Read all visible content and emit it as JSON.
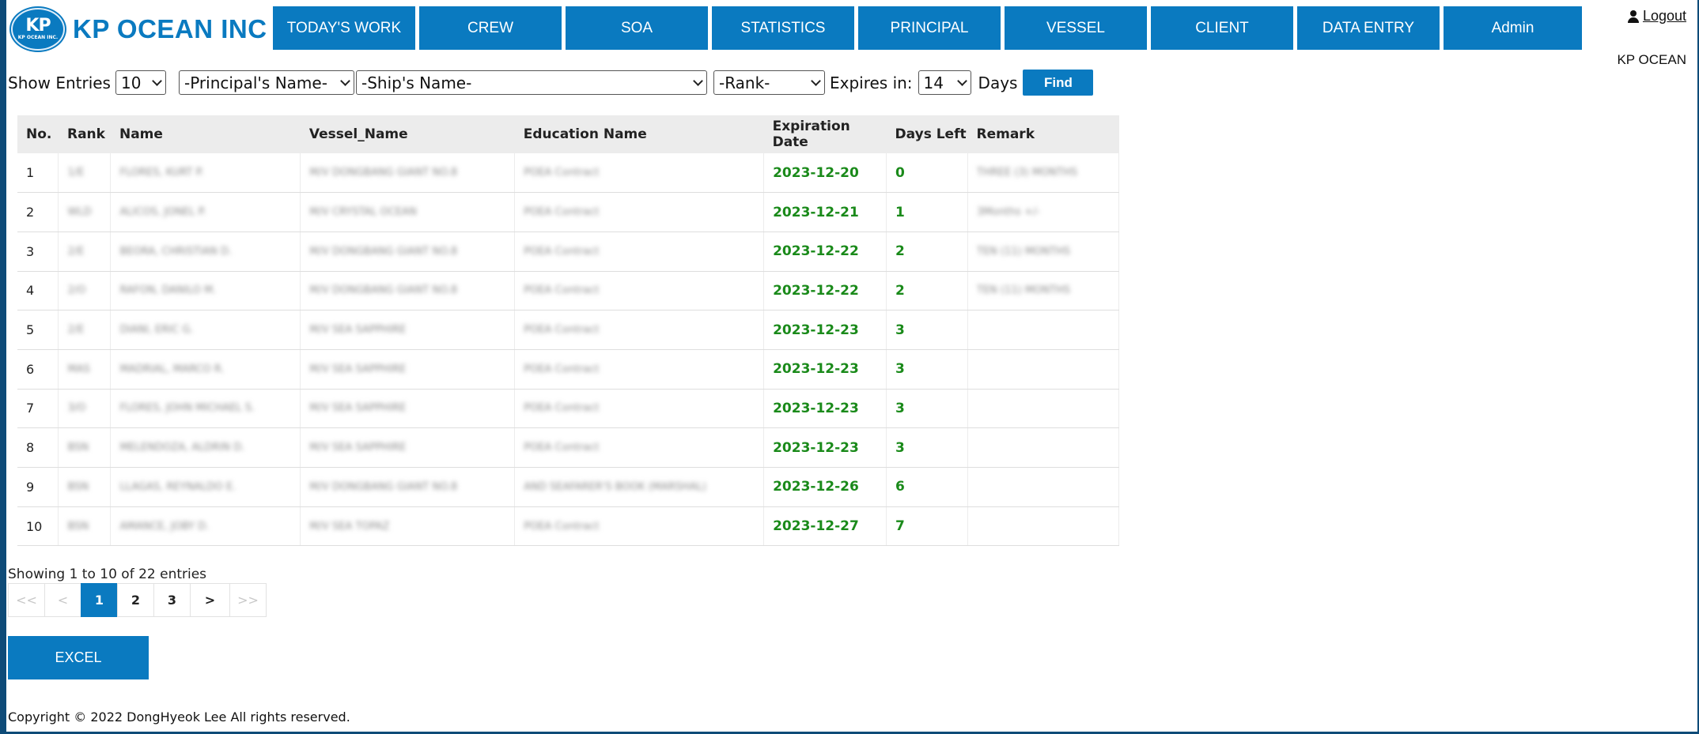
{
  "header": {
    "logo_mark": "KP",
    "logo_sub": "KP OCEAN INC.",
    "brand": "KP OCEAN INC",
    "nav": [
      "TODAY'S WORK",
      "CREW",
      "SOA",
      "STATISTICS",
      "PRINCIPAL",
      "VESSEL",
      "CLIENT",
      "DATA ENTRY",
      "Admin"
    ],
    "logout": "Logout",
    "company": "KP OCEAN"
  },
  "filters": {
    "show_label": "Show Entries",
    "entries_value": "10",
    "principal_value": "-Principal's Name-",
    "ship_value": "-Ship's Name-",
    "rank_value": "-Rank-",
    "expires_label": "Expires in:",
    "expires_value": "14",
    "days_label": "Days",
    "find": "Find"
  },
  "table": {
    "columns": [
      "No.",
      "Rank",
      "Name",
      "Vessel_Name",
      "Education Name",
      "Expiration Date",
      "Days Left",
      "Remark"
    ],
    "rows": [
      {
        "no": "1",
        "rank": "1/E",
        "name": "FLORES, KURT P.",
        "vessel": "M/V DONGBANG GIANT NO.8",
        "education": "POEA Contract",
        "expiration": "2023-12-20",
        "days": "0",
        "remark": "THREE (3) MONTHS"
      },
      {
        "no": "2",
        "rank": "WLD",
        "name": "ALICOS, JONEL P.",
        "vessel": "M/V CRYSTAL OCEAN",
        "education": "POEA Contract",
        "expiration": "2023-12-21",
        "days": "1",
        "remark": "3Months +/-"
      },
      {
        "no": "3",
        "rank": "2/E",
        "name": "BEORA, CHRISTIAN D.",
        "vessel": "M/V DONGBANG GIANT NO.8",
        "education": "POEA Contract",
        "expiration": "2023-12-22",
        "days": "2",
        "remark": "TEN (11) MONTHS"
      },
      {
        "no": "4",
        "rank": "2/O",
        "name": "RAFON, DANILO M.",
        "vessel": "M/V DONGBANG GIANT NO.8",
        "education": "POEA Contract",
        "expiration": "2023-12-22",
        "days": "2",
        "remark": "TEN (11) MONTHS"
      },
      {
        "no": "5",
        "rank": "2/E",
        "name": "DIANI, ERIC G.",
        "vessel": "M/V SEA SAPPHIRE",
        "education": "POEA Contract",
        "expiration": "2023-12-23",
        "days": "3",
        "remark": ""
      },
      {
        "no": "6",
        "rank": "MAS",
        "name": "MADRIAL, MARCO R.",
        "vessel": "M/V SEA SAPPHIRE",
        "education": "POEA Contract",
        "expiration": "2023-12-23",
        "days": "3",
        "remark": ""
      },
      {
        "no": "7",
        "rank": "3/O",
        "name": "FLORES, JOHN MICHAEL S.",
        "vessel": "M/V SEA SAPPHIRE",
        "education": "POEA Contract",
        "expiration": "2023-12-23",
        "days": "3",
        "remark": ""
      },
      {
        "no": "8",
        "rank": "BSN",
        "name": "MELENDOZA, ALDRIN D.",
        "vessel": "M/V SEA SAPPHIRE",
        "education": "POEA Contract",
        "expiration": "2023-12-23",
        "days": "3",
        "remark": ""
      },
      {
        "no": "9",
        "rank": "BSN",
        "name": "LLAGAS, REYNALDO E.",
        "vessel": "M/V DONGBANG GIANT NO.8",
        "education": "AND SEAFARER'S BOOK (MARSHAL)",
        "expiration": "2023-12-26",
        "days": "6",
        "remark": ""
      },
      {
        "no": "10",
        "rank": "BSN",
        "name": "AMANCE, JOBY D.",
        "vessel": "M/V SEA TOPAZ",
        "education": "POEA Contract",
        "expiration": "2023-12-27",
        "days": "7",
        "remark": ""
      }
    ]
  },
  "pagination": {
    "showing": "Showing 1 to 10 of 22 entries",
    "first": "<<",
    "prev": "<",
    "pages": [
      "1",
      "2",
      "3"
    ],
    "next": ">",
    "last": ">>",
    "current": "1"
  },
  "excel": "EXCEL",
  "footer": "Copyright © 2022 DongHyeok Lee All rights reserved.",
  "colors": {
    "brand": "#0a7ac0",
    "green": "#1a8a1a",
    "frame": "#0e4b78"
  }
}
